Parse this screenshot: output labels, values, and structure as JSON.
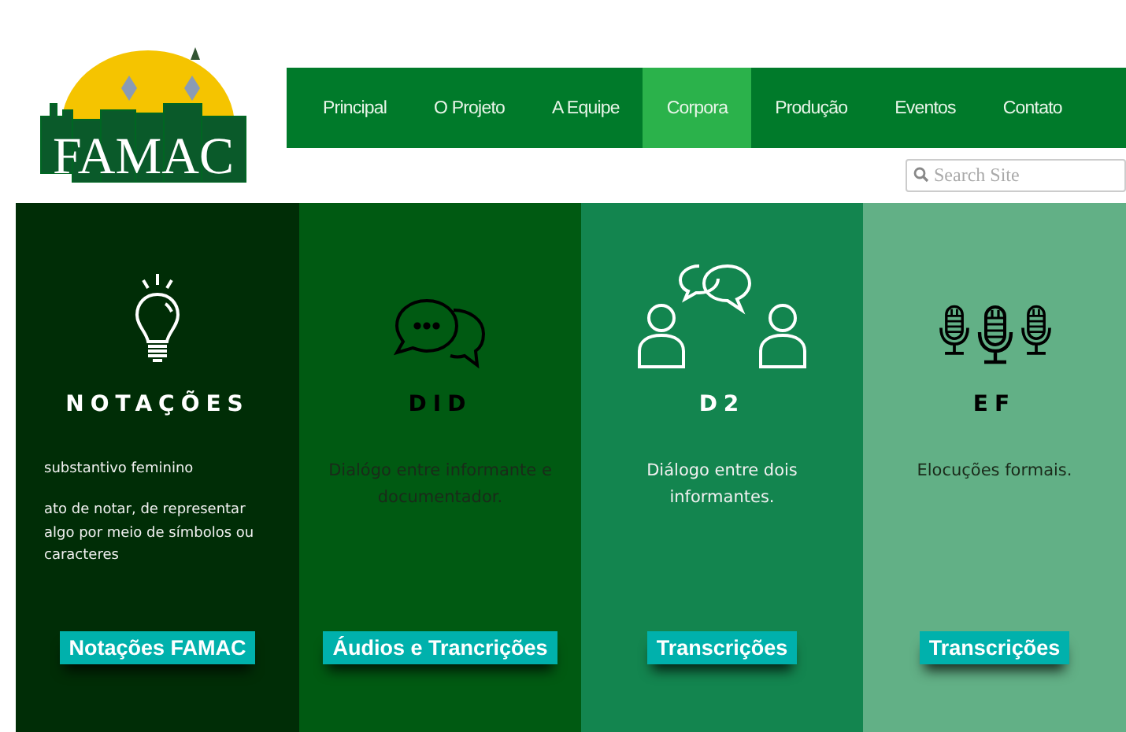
{
  "logo": {
    "text": "FAMAC"
  },
  "nav": [
    {
      "label": "Principal",
      "selected": false
    },
    {
      "label": "O Projeto",
      "selected": false
    },
    {
      "label": "A Equipe",
      "selected": false
    },
    {
      "label": "Corpora",
      "selected": true
    },
    {
      "label": "Produção",
      "selected": false
    },
    {
      "label": "Eventos",
      "selected": false
    },
    {
      "label": "Contato",
      "selected": false
    }
  ],
  "search": {
    "placeholder": "Search Site"
  },
  "cards": [
    {
      "kind": "bulb",
      "light_text": true,
      "color": "#002d06",
      "title": "NOTAÇÕES",
      "lines": [
        "substantivo feminino",
        "ato de notar, de representar algo por meio de símbolos ou caracteres"
      ],
      "button": "Notações FAMAC"
    },
    {
      "kind": "chat",
      "light_text": false,
      "color": "#005a12",
      "title": "DID",
      "lines": [
        "Dialógo entre informante e documentador."
      ],
      "button": "Áudios e Trancrições"
    },
    {
      "kind": "people",
      "light_text": true,
      "color": "#13854f",
      "title": "D2",
      "lines": [
        "Diálogo entre dois informantes."
      ],
      "button": "Transcrições"
    },
    {
      "kind": "mics",
      "light_text": false,
      "color": "#62b086",
      "title": "EF",
      "lines": [
        "Elocuções formais."
      ],
      "button": "Transcrições"
    }
  ]
}
